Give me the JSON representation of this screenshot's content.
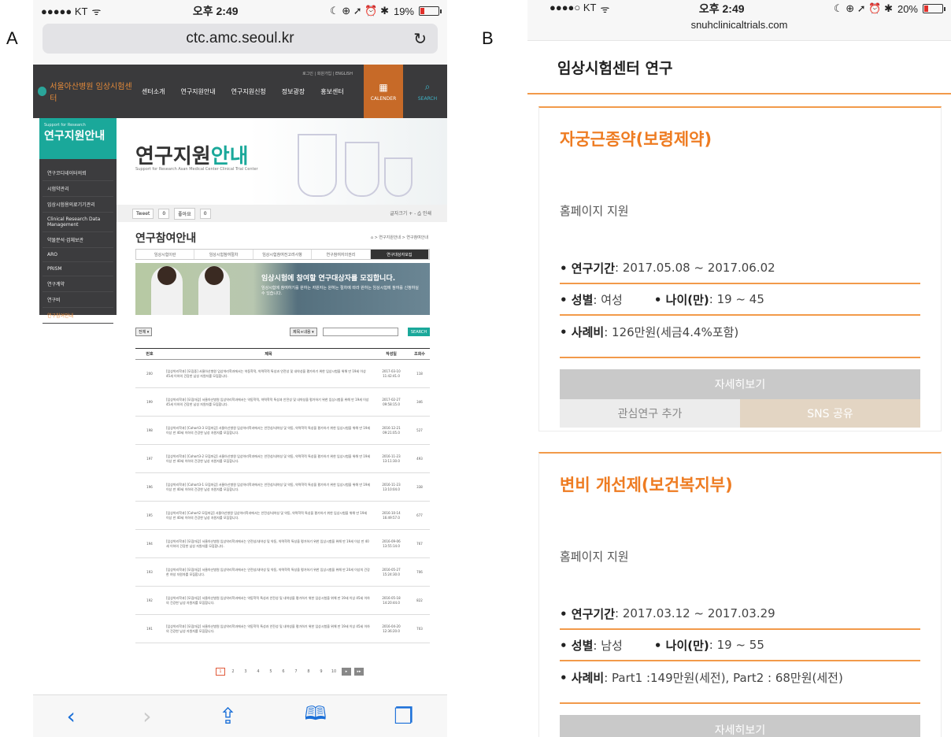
{
  "labels": {
    "a": "A",
    "b": "B"
  },
  "panel_a": {
    "status": {
      "carrier": "●●●●● KT",
      "wifi": "ᯤ",
      "time": "오후 2:49",
      "icons": "☾ ⊕ ➚ ⏰ ✱",
      "battery": "19%",
      "battery_level": 0.19
    },
    "url": "ctc.amc.seoul.kr",
    "reload": "↻",
    "site": {
      "logo": "서울아산병원 임상시험센터",
      "menu": [
        "센터소개",
        "연구지원안내",
        "연구지원신청",
        "정보광장",
        "홍보센터"
      ],
      "util": "로그인 | 회원가입 | ENGLISH",
      "calendar": "CALENDER",
      "search": "SEARCH",
      "side_head_small": "Support for Research",
      "side_head": "연구지원안내",
      "side_items": [
        "연구코디네이터의뢰",
        "시험약관리",
        "임상시험용의료기기관리",
        "Clinical Research Data Management",
        "약물분석·검체보관",
        "ARO",
        "PRISM",
        "연구계약",
        "연구비",
        "연구참여안내"
      ],
      "hero_title_a": "연구지원",
      "hero_title_b": "안내",
      "hero_sub": "Support for Research Asan Medical Center Clinical Trial Center",
      "tweet": "Tweet",
      "like": "좋아요",
      "zero": "0",
      "share_right": "글자크기 + - ⎙ 인쇄",
      "page_title": "연구참여안내",
      "breadcrumb": "⌂ > 연구지원안내 > 연구참여안내",
      "subtabs": [
        "임상시험이란",
        "임상시험참여절차",
        "임상시험참여전고려사항",
        "연구참여자의권리",
        "연구대상자모집"
      ],
      "banner_title": "임상시험에 참여할 연구대상자를 모집합니다.",
      "banner_text": "임상시험에 참여하기를 원하는 자원자는 원하는 절차에 따라 원하는 임상시험에 참여를 신청하실 수 있습니다.",
      "filter_all": "전체 ▾",
      "filter_field": "제목+내용 ▾",
      "search_btn": "SEARCH",
      "table_headers": [
        "번호",
        "제목",
        "작성일",
        "조회수"
      ],
      "rows": [
        {
          "no": "200",
          "title": "[임상약리학과] [모집중] 서울아산병원 임상약리학과에서는 약동학적, 약력학적 특성과 안전성 및 내약성을 평가하기 위한 임상시험을 위해 만 19세 이상 45세 이하의 건강한 남성 자원자를 모집합니다.",
          "date": "2017-03-10 11:42:41.0",
          "views": "118"
        },
        {
          "no": "199",
          "title": "[임상약리학과] [모집마감] 서울아산병원 임상약리학과에서는 약동학적, 약력학적 특성과 안전성 및 내약성을 평가하기 위한 임상시험을 위해 만 19세 이상 45세 이하의 건강한 남성 자원자를 모집합니다.",
          "date": "2017-02-27 09:58:15.0",
          "views": "346"
        },
        {
          "no": "198",
          "title": "[임상약리학과] [Cohort3-3 모집마감] 서울아산병원 임상약리학과에서는 안전성/내약성 및 약동, 약력학적 특성을 평가하기 위한 임상시험을 위해 만 19세 이상 만 40세 이하의 건강한 남성 자원자를 모집합니다.",
          "date": "2016-12-21 09:21:05.0",
          "views": "527"
        },
        {
          "no": "197",
          "title": "[임상약리학과] [Cohort3-2 모집마감] 서울아산병원 임상약리학과에서는 안전성/내약성 및 약동, 약력학적 특성을 평가하기 위한 임상시험을 위해 만 19세 이상 만 40세 이하의 건강한 남성 자원자를 모집합니다.",
          "date": "2016-11-23 13:11:30.0",
          "views": "493"
        },
        {
          "no": "196",
          "title": "[임상약리학과] [Cohort3-1 모집마감] 서울아산병원 임상약리학과에서는 안전성/내약성 및 약동, 약력학적 특성을 평가하기 위한 임상시험을 위해 만 19세 이상 만 40세 이하의 건강한 남성 자원자를 모집합니다.",
          "date": "2016-11-23 13:10:04.0",
          "views": "338"
        },
        {
          "no": "195",
          "title": "[임상약리학과] [Cohort2 모집마감] 서울아산병원 임상약리학과에서는 안전성/내약성 및 약동, 약력학적 특성을 평가하기 위한 임상시험을 위해 만 19세 이상 만 40세 이하의 건강한 남성 자원자를 모집합니다.",
          "date": "2016-10-14 16:49:57.0",
          "views": "677"
        },
        {
          "no": "194",
          "title": "[임상약리학과] [모집마감] 서울아산병원 임상약리학과에서는 안전성/내약성 및 약동, 약력학적 특성을 평가하기 위한 임상시험을 위해 만 19세 이상 만 40세 이하의 건강한 남성 자원자를 모집합니다.",
          "date": "2016-09-06 13:55:14.0",
          "views": "767"
        },
        {
          "no": "193",
          "title": "[임상약리학과] [모집마감] 서울아산병원 임상약리학과에서는 안전성/내약성 및 약동, 약력학적 특성을 평가하기 위한 임상시험을 위해 만 20세 이상의 건강한 여성 자원자를 모집합니다.",
          "date": "2016-05-27 15:24:30.0",
          "views": "706"
        },
        {
          "no": "192",
          "title": "[임상약리학과] [모집마감] 서울아산병원 임상약리학과에서는 약동학적 특성과 안전성 및 내약성을 평가하기 위한 임상시험을 위해 만 19세 이상 45세 이하의 건강한 남성 자원자를 모집합니다.",
          "date": "2016-05-18 14:20:44.0",
          "views": "822"
        },
        {
          "no": "191",
          "title": "[임상약리학과] [모집마감] 서울아산병원 임상약리학과에서는 약동학적 특성과 안전성 및 내약성을 평가하기 위한 임상시험을 위해 만 19세 이상 45세 이하의 건강한 남성 자원자를 모집합니다.",
          "date": "2016-04-20 12:36:20.0",
          "views": "703"
        }
      ],
      "pages": [
        "1",
        "2",
        "3",
        "4",
        "5",
        "6",
        "7",
        "8",
        "9",
        "10"
      ],
      "next": "▸",
      "last": "▸▸"
    },
    "toolbar": {
      "back": "‹",
      "forward": "›",
      "share": "⇪",
      "bookmarks": "📖",
      "tabs": "❐"
    }
  },
  "panel_b": {
    "status": {
      "carrier": "●●●●○ KT",
      "wifi": "ᯤ",
      "time": "오후 2:49",
      "icons": "☾ ⊕ ➚ ⏰ ✱",
      "battery": "20%",
      "battery_level": 0.2
    },
    "host": "snuhclinicaltrials.com",
    "header": "임상시험센터 연구",
    "cards": [
      {
        "title": "자궁근종약(보령제약)",
        "support": "홈페이지 지원",
        "period_label": "• 연구기간",
        "period": ": 2017.05.08 ~ 2017.06.02",
        "sex_label": "• 성별",
        "sex": ": 여성",
        "age_label": "• 나이(만)",
        "age": ": 19 ~ 45",
        "fee_label": "• 사례비",
        "fee": ": 126만원(세금4.4%포함)",
        "detail_btn": "자세히보기",
        "interest_btn": "관심연구 추가",
        "sns_btn": "SNS 공유"
      },
      {
        "title": "변비 개선제(보건복지부)",
        "support": "홈페이지 지원",
        "period_label": "• 연구기간",
        "period": ": 2017.03.12 ~ 2017.03.29",
        "sex_label": "• 성별",
        "sex": ": 남성",
        "age_label": "• 나이(만)",
        "age": ": 19 ~ 55",
        "fee_label": "• 사례비",
        "fee": ": Part1 :149만원(세전), Part2 : 68만원(세전)",
        "detail_btn": "자세히보기"
      }
    ]
  },
  "colors": {
    "accent_orange": "#ee7c22",
    "teal": "#1aa89a",
    "ios_blue": "#1a6fd8"
  }
}
